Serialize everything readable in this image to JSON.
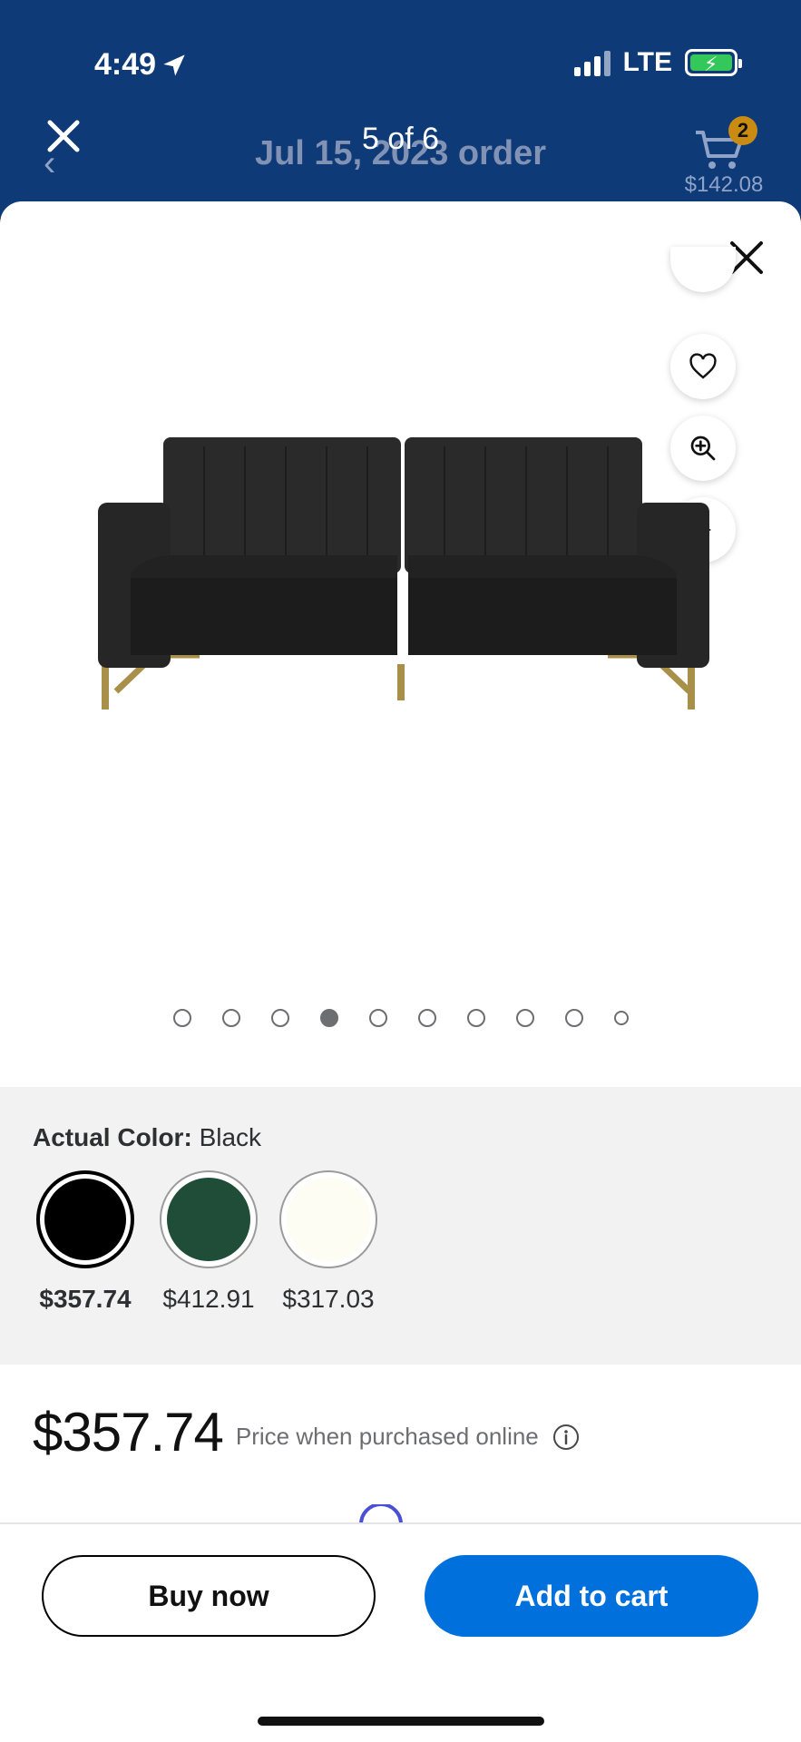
{
  "status_bar": {
    "time": "4:49",
    "network": "LTE",
    "colors": {
      "battery_fill": "#34c759"
    }
  },
  "header": {
    "counter": "5 of 6",
    "background_title": "Jul 15, 2023 order",
    "cart_count": "2",
    "cart_total": "$142.08",
    "colors": {
      "background": "#0e3a78",
      "badge": "#c98b12"
    }
  },
  "gallery": {
    "actions": [
      "heart-icon",
      "zoom-in-icon",
      "play-icon"
    ],
    "dots": {
      "total": 10,
      "active_index": 3
    }
  },
  "color_selector": {
    "label_key": "Actual Color:",
    "label_value": "Black",
    "options": [
      {
        "name": "Black",
        "hex": "#000000",
        "price": "$357.74",
        "selected": true
      },
      {
        "name": "Green",
        "hex": "#1f4d38",
        "price": "$412.91",
        "selected": false
      },
      {
        "name": "Ivory",
        "hex": "#fdfdf3",
        "price": "$317.03",
        "selected": false
      }
    ]
  },
  "price": {
    "amount": "$357.74",
    "note": "Price when purchased online"
  },
  "buttons": {
    "buy_now": "Buy now",
    "add_to_cart": "Add to cart"
  },
  "colors": {
    "accent": "#0071dc",
    "section_bg": "#f2f2f2"
  }
}
